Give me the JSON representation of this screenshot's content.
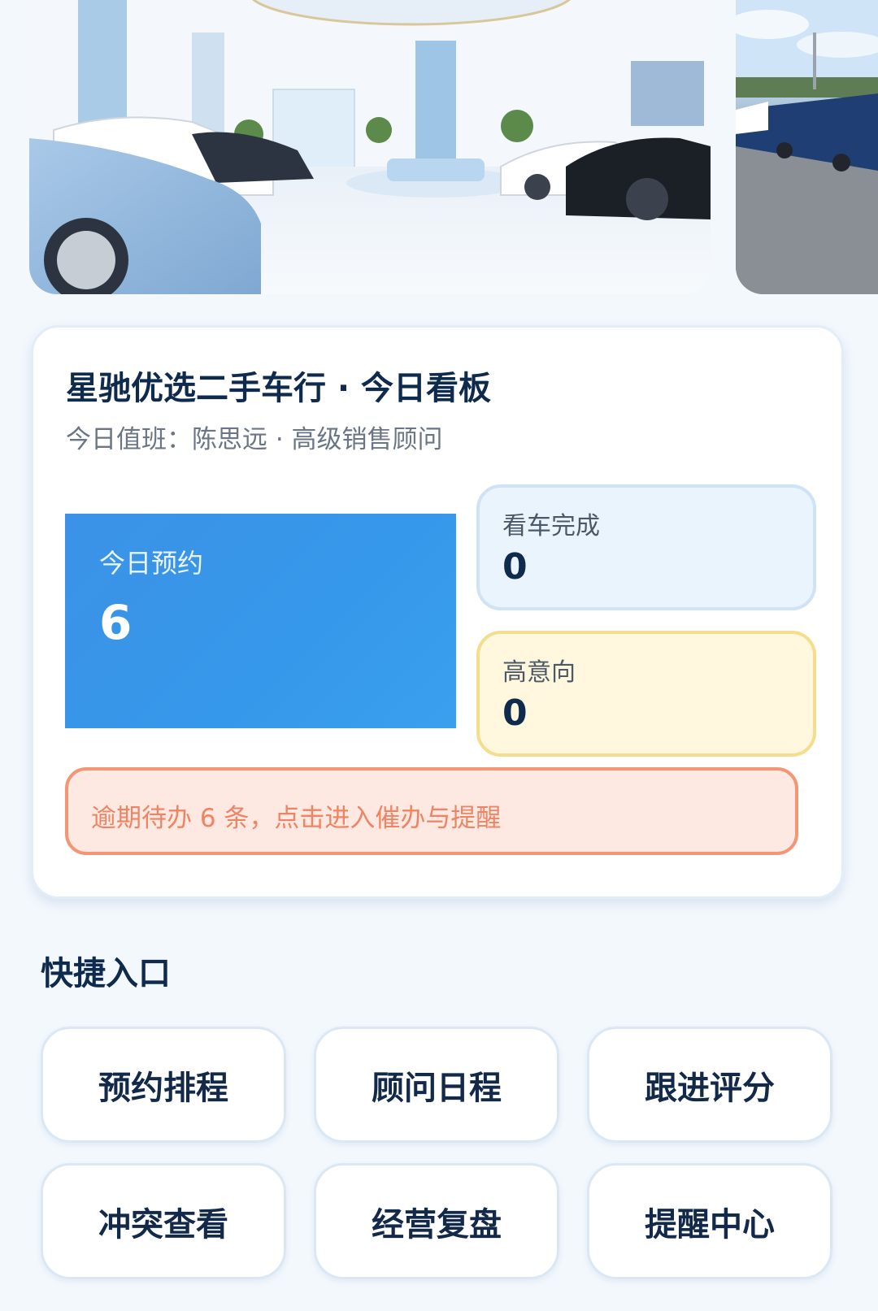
{
  "dashboard": {
    "title": "星驰优选二手车行 · 今日看板",
    "subtitle": "今日值班：陈思远 · 高级销售顾问",
    "stats": {
      "appointments": {
        "label": "今日预约",
        "value": "6",
        "color": "#3796e8"
      },
      "visits_done": {
        "label": "看车完成",
        "value": "0",
        "color": "#eaf4fc"
      },
      "high_intent": {
        "label": "高意向",
        "value": "0",
        "color": "#fff8de"
      }
    },
    "overdue": {
      "text": "逾期待办 6 条，点击进入催办与提醒",
      "color": "#ee8463"
    }
  },
  "quick": {
    "title": "快捷入口",
    "items": [
      {
        "label": "预约排程",
        "icon": "none"
      },
      {
        "label": "顾问日程",
        "icon": "none"
      },
      {
        "label": "跟进评分",
        "icon": "none"
      },
      {
        "label": "冲突查看",
        "icon": "none"
      },
      {
        "label": "经营复盘",
        "icon": "none"
      },
      {
        "label": "提醒中心",
        "icon": "none"
      }
    ]
  },
  "banners": [
    {
      "image": "car-showroom-photo"
    },
    {
      "image": "car-parking-lot-photo"
    }
  ]
}
